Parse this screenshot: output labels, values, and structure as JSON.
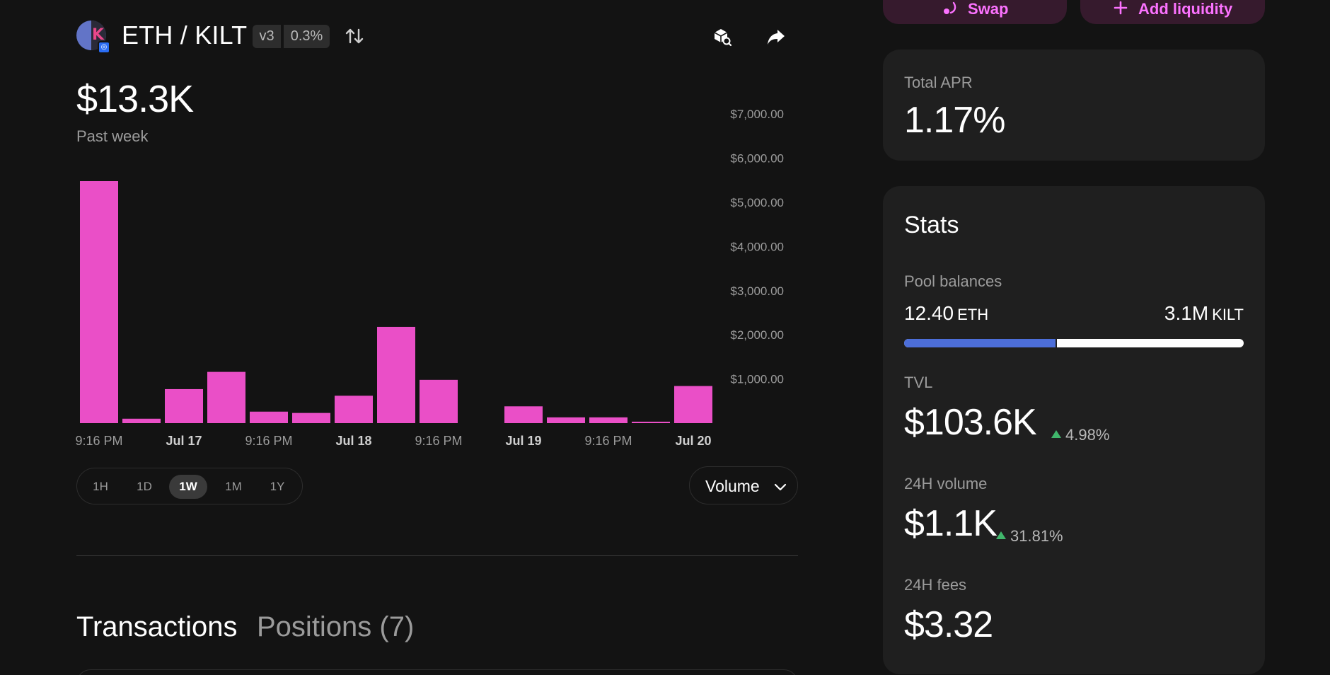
{
  "header": {
    "pair": "ETH / KILT",
    "version": "v3",
    "fee_tier": "0.3%",
    "icons": [
      "eth-kilt-pair-logo",
      "chain-badge-icon",
      "swap-direction-icon",
      "explorer-icon",
      "share-icon"
    ]
  },
  "summary": {
    "value": "$13.3K",
    "period": "Past week"
  },
  "chart_data": {
    "type": "bar",
    "color": "#ea4fc7",
    "values": [
      5480,
      100,
      770,
      1160,
      260,
      230,
      620,
      2180,
      980,
      0,
      380,
      130,
      130,
      30,
      840
    ],
    "yticks": [
      "$7,000.00",
      "$6,000.00",
      "$5,000.00",
      "$4,000.00",
      "$3,000.00",
      "$2,000.00",
      "$1,000.00"
    ],
    "ytick_values": [
      7000,
      6000,
      5000,
      4000,
      3000,
      2000,
      1000
    ],
    "ylim": [
      0,
      7500
    ],
    "xticks": [
      {
        "label": "9:16 PM",
        "index": 0,
        "bold": false
      },
      {
        "label": "Jul 17",
        "index": 2,
        "bold": true
      },
      {
        "label": "9:16 PM",
        "index": 4,
        "bold": false
      },
      {
        "label": "Jul 18",
        "index": 6,
        "bold": true
      },
      {
        "label": "9:16 PM",
        "index": 8,
        "bold": false
      },
      {
        "label": "Jul 19",
        "index": 10,
        "bold": true
      },
      {
        "label": "9:16 PM",
        "index": 12,
        "bold": false
      },
      {
        "label": "Jul 20",
        "index": 14,
        "bold": true
      }
    ],
    "grid": false
  },
  "time_range": {
    "options": [
      "1H",
      "1D",
      "1W",
      "1M",
      "1Y"
    ],
    "selected": "1W"
  },
  "metric_select": {
    "value": "Volume"
  },
  "tabs": {
    "transactions": "Transactions",
    "positions": "Positions (7)"
  },
  "actions": {
    "swap": "Swap",
    "add_liquidity": "Add liquidity",
    "accent": "#fc72ff"
  },
  "apr": {
    "label": "Total APR",
    "value": "1.17%"
  },
  "stats": {
    "title": "Stats",
    "pool_balances": {
      "label": "Pool balances",
      "token0_amount": "12.40",
      "token0_symbol": "ETH",
      "token1_amount": "3.1M",
      "token1_symbol": "KILT",
      "token0_share": 0.45
    },
    "tvl": {
      "label": "TVL",
      "value": "$103.6K",
      "change": "4.98%"
    },
    "volume_24h": {
      "label": "24H volume",
      "value": "$1.1K",
      "change": "31.81%"
    },
    "fees_24h": {
      "label": "24H fees",
      "value": "$3.32"
    }
  }
}
